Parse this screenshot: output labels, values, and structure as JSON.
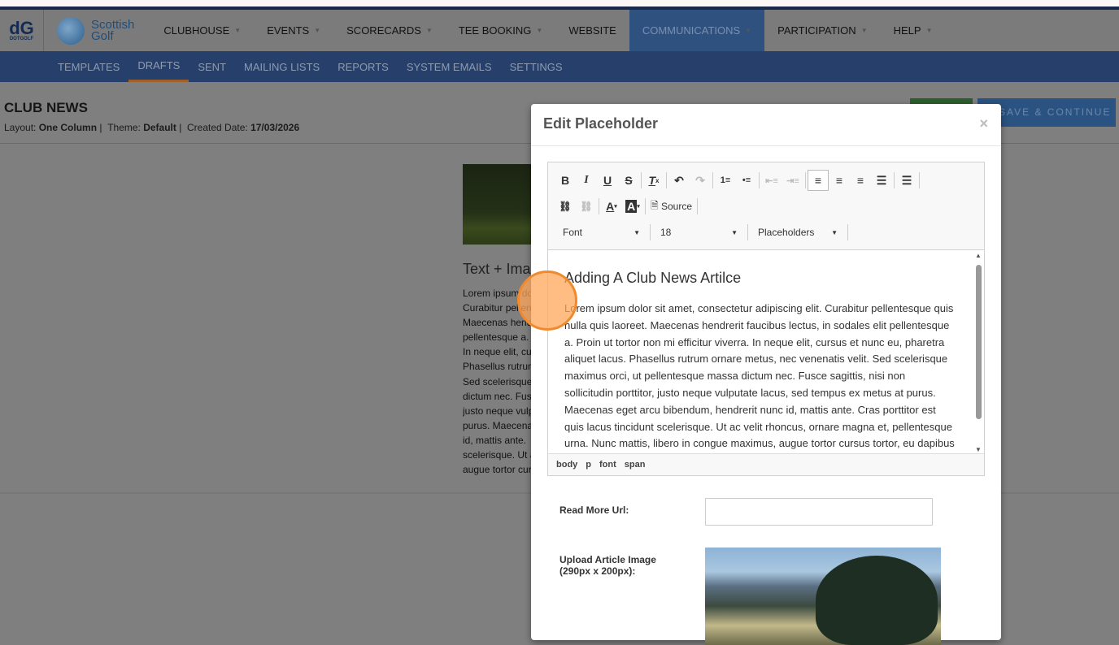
{
  "brand": {
    "dotgolf": "DOTGOLF",
    "scottish": "Scottish",
    "golf": "Golf"
  },
  "nav": [
    {
      "label": "CLUBHOUSE",
      "caret": true
    },
    {
      "label": "EVENTS",
      "caret": true
    },
    {
      "label": "SCORECARDS",
      "caret": true
    },
    {
      "label": "TEE BOOKING",
      "caret": true
    },
    {
      "label": "WEBSITE",
      "caret": false
    },
    {
      "label": "COMMUNICATIONS",
      "caret": true,
      "active": true
    },
    {
      "label": "PARTICIPATION",
      "caret": true
    },
    {
      "label": "HELP",
      "caret": true
    }
  ],
  "subnav": [
    {
      "label": "TEMPLATES"
    },
    {
      "label": "DRAFTS",
      "active": true
    },
    {
      "label": "SENT"
    },
    {
      "label": "MAILING LISTS"
    },
    {
      "label": "REPORTS"
    },
    {
      "label": "SYSTEM EMAILS"
    },
    {
      "label": "SETTINGS"
    }
  ],
  "page": {
    "title": "CLUB NEWS",
    "layout_label": "Layout:",
    "layout": "One Column",
    "theme_label": "Theme:",
    "theme": "Default",
    "created_label": "Created Date:",
    "created": "17/03/2026",
    "save_continue": "SAVE & CONTINUE",
    "bg_heading": "Text + Image",
    "bg_lines": [
      "Lorem ipsum dolor",
      "Curabitur pellentesque",
      "Maecenas hendrerit",
      "pellentesque a.",
      "In neque elit, cursus",
      "Phasellus rutrum",
      "Sed scelerisque",
      "dictum nec. Fusce",
      "justo neque vulputate",
      "purus. Maecenas",
      "id, mattis ante.",
      "scelerisque. Ut ac",
      "augue tortor cursus"
    ]
  },
  "modal": {
    "title": "Edit Placeholder",
    "close": "×",
    "toolbar": {
      "source": "Source",
      "font": "Font",
      "size": "18",
      "placeholders": "Placeholders"
    },
    "heading": "Adding A Club News Artilce",
    "lines": [
      "Lorem ipsum dolor sit amet, consectetur adipiscing elit. Curabitur pellentesque quis",
      "nulla quis laoreet. Maecenas hendrerit faucibus lectus, in sodales elit pellentesque",
      "a. Proin ut tortor non mi efficitur viverra. In neque elit, cursus et nunc eu, pharetra",
      "aliquet lacus. Phasellus rutrum ornare metus, nec venenatis velit. Sed scelerisque",
      "maximus orci, ut pellentesque massa dictum nec. Fusce sagittis, nisi non",
      "sollicitudin porttitor, justo neque vulputate lacus, sed tempus ex metus at purus.",
      "Maecenas eget arcu bibendum, hendrerit nunc id, mattis ante. Cras porttitor est",
      "quis lacus tincidunt scelerisque. Ut ac velit rhoncus, ornare magna et, pellentesque",
      "urna. Nunc mattis, libero in congue maximus, augue tortor cursus tortor, eu dapibus"
    ],
    "path": [
      "body",
      "p",
      "font",
      "span"
    ],
    "read_more_label": "Read More Url:",
    "read_more_value": "",
    "upload_label_1": "Upload Article Image",
    "upload_label_2": "(290px x 200px):"
  }
}
